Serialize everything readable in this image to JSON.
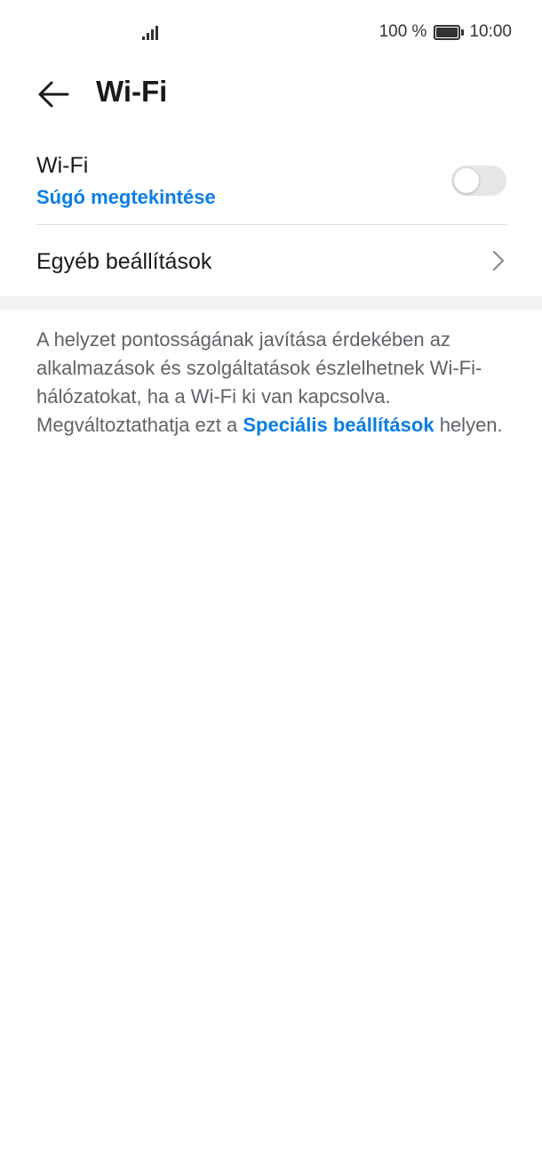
{
  "status": {
    "battery_text": "100 %",
    "time": "10:00"
  },
  "header": {
    "title": "Wi-Fi"
  },
  "wifi": {
    "label": "Wi-Fi",
    "help_link": "Súgó megtekintése",
    "enabled": false
  },
  "other_settings": {
    "label": "Egyéb beállítások"
  },
  "info": {
    "text_before": "A helyzet pontosságának javítása érdekében az alkalmazások és szolgáltatások észlelhetnek Wi-Fi-hálózatokat, ha a Wi-Fi ki van kapcsolva. Megváltoztathatja ezt a ",
    "link": "Speciális beállítások",
    "text_after": " helyen."
  },
  "colors": {
    "accent": "#0a7ee6",
    "toggle_off": "#e6e6e6",
    "section_gap": "#f1f3f5"
  },
  "icons": {
    "back": "arrow-left-icon",
    "chevron": "chevron-right-icon",
    "signal": "signal-icon",
    "battery": "battery-icon"
  }
}
